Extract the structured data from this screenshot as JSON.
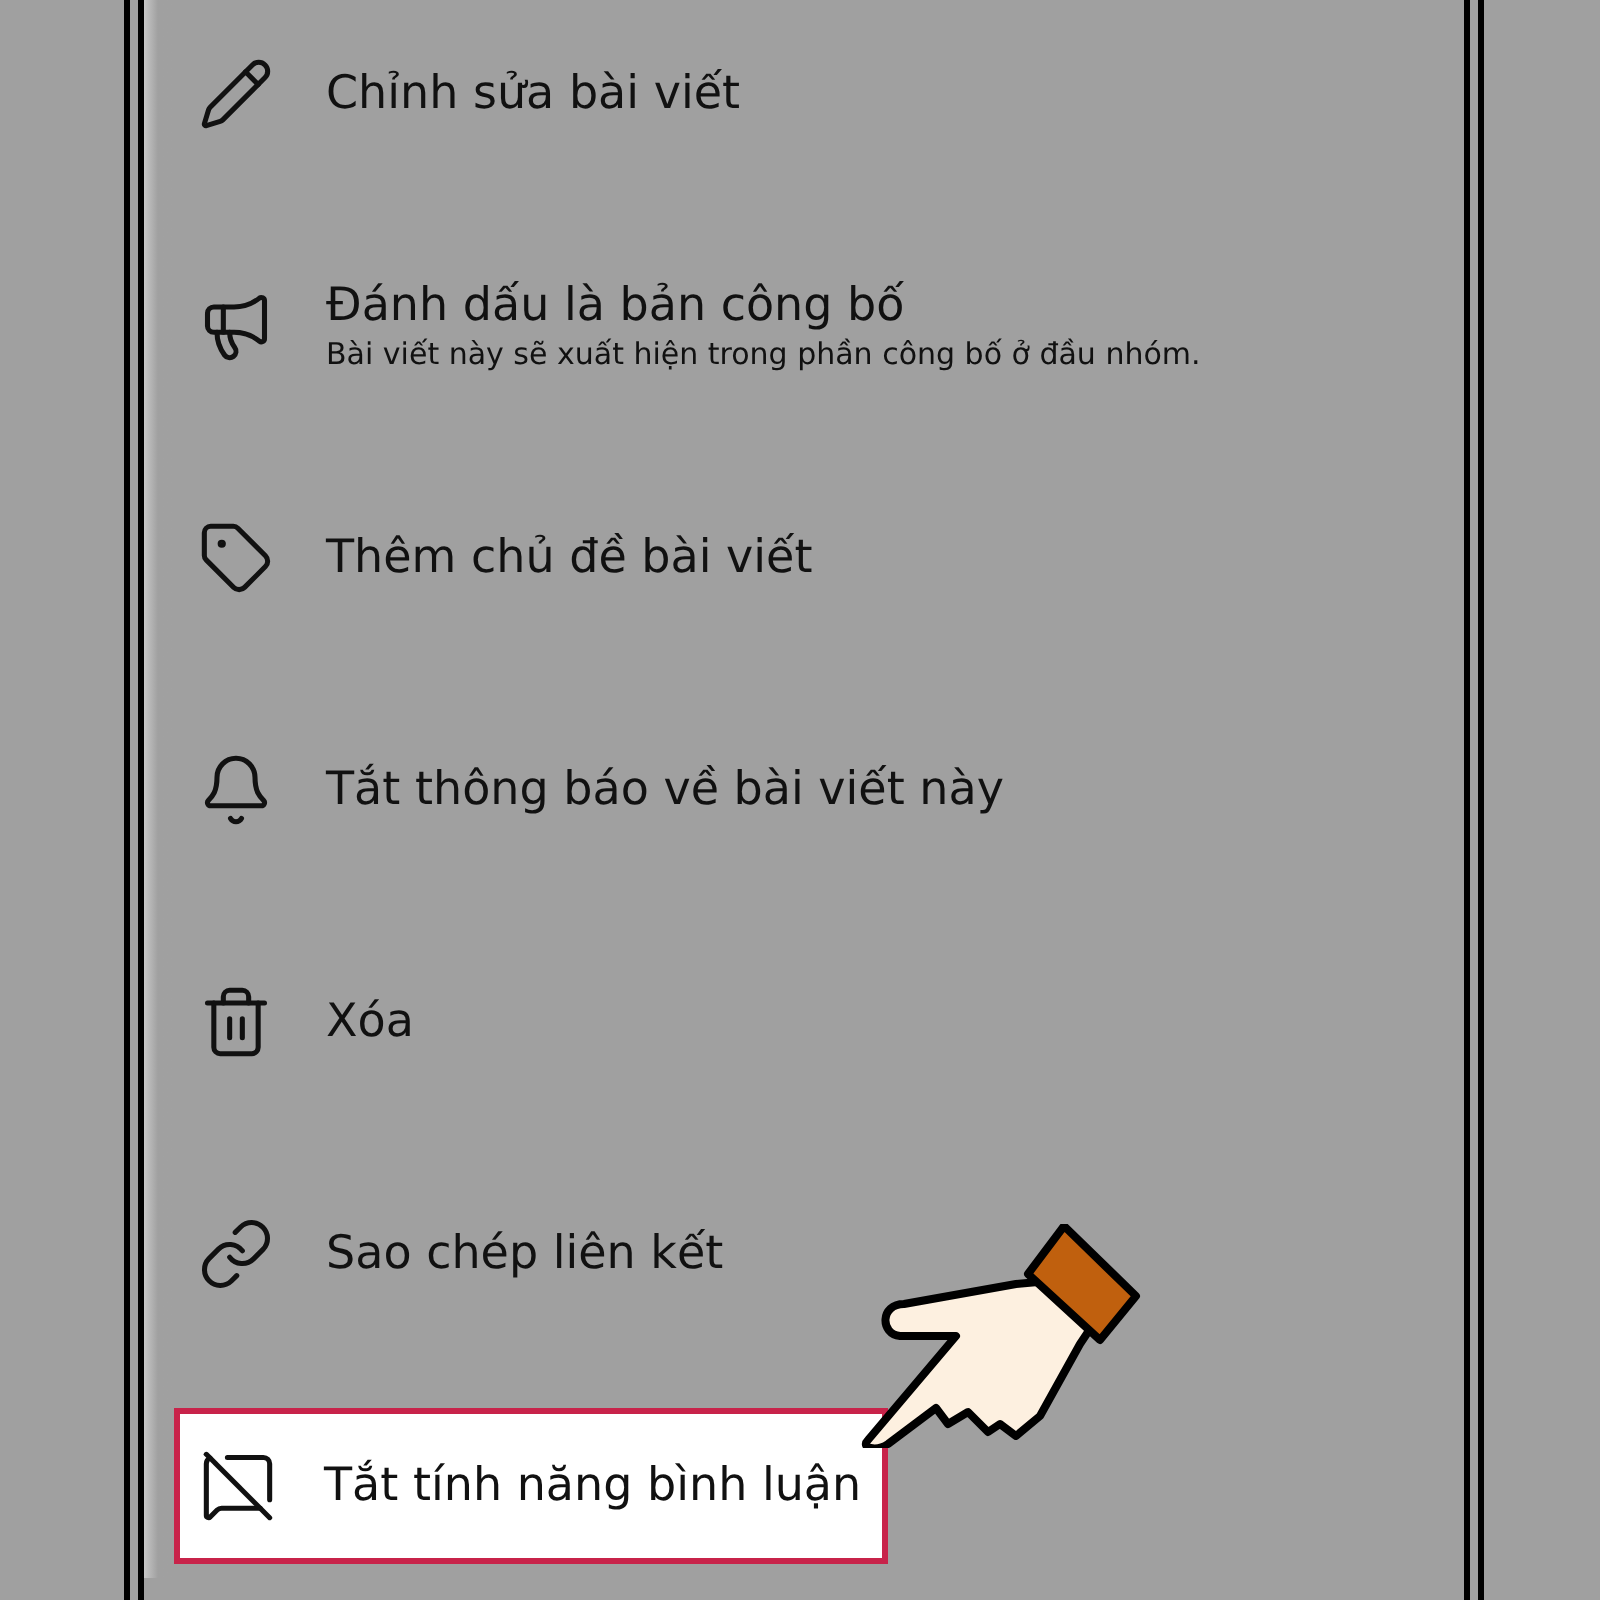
{
  "menu": {
    "items": [
      {
        "kind": "edit",
        "label": "Chỉnh sửa bài viết",
        "highlighted": false
      },
      {
        "kind": "announce",
        "label": "Đánh dấu là bản công bố",
        "description": "Bài viết này sẽ xuất hiện trong phần công bố ở đầu nhóm.",
        "highlighted": false
      },
      {
        "kind": "topic",
        "label": "Thêm chủ đề bài viết",
        "highlighted": false
      },
      {
        "kind": "notify",
        "label": "Tắt thông báo về bài viết này",
        "highlighted": false
      },
      {
        "kind": "delete",
        "label": "Xóa",
        "highlighted": false
      },
      {
        "kind": "link",
        "label": "Sao chép liên kết",
        "highlighted": false
      },
      {
        "kind": "comments-off",
        "label": "Tắt tính năng bình luận",
        "highlighted": true
      }
    ]
  }
}
